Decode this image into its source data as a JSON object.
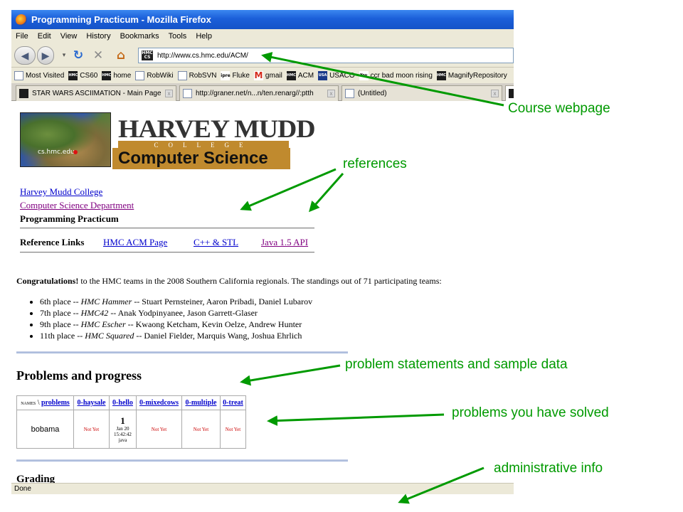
{
  "window": {
    "title": "Programming Practicum - Mozilla Firefox"
  },
  "menu": [
    "File",
    "Edit",
    "View",
    "History",
    "Bookmarks",
    "Tools",
    "Help"
  ],
  "nav": {
    "url": "http://www.cs.hmc.edu/ACM/",
    "url_favicon": "HMC CS"
  },
  "bookmarks": [
    {
      "label": "Most Visited",
      "icon": "page"
    },
    {
      "label": "CS60",
      "icon": "hmc"
    },
    {
      "label": "home",
      "icon": "hmc"
    },
    {
      "label": "RobWiki",
      "icon": "page"
    },
    {
      "label": "RobSVN",
      "icon": "page"
    },
    {
      "label": "Fluke",
      "icon": "ipre"
    },
    {
      "label": "gmail",
      "icon": "mail"
    },
    {
      "label": "ACM",
      "icon": "hmc"
    },
    {
      "label": "USACO",
      "icon": "usaco"
    },
    {
      "label": "ccr bad moon rising",
      "icon": "youtube"
    },
    {
      "label": "MagnifyRepository",
      "icon": "hmc"
    }
  ],
  "tabs": [
    {
      "label": "STAR WARS ASCIIMATION - Main Page"
    },
    {
      "label": "http://graner.net/n...n/ten.renarg//:ptth"
    },
    {
      "label": "(Untitled)"
    }
  ],
  "page": {
    "logo": {
      "name_line": "HARVEY MUDD",
      "college_line": "COLLEGE",
      "dept_line": "Computer Science",
      "map_label": "cs.hmc.edu"
    },
    "breadcrumbs": {
      "college": "Harvey Mudd College",
      "dept": "Computer Science Department",
      "current": "Programming Practicum"
    },
    "reference": {
      "label": "Reference Links",
      "links": [
        "HMC ACM Page",
        "C++ & STL",
        "Java 1.5 API"
      ]
    },
    "congrats": {
      "lead": "Congratulations!",
      "text": " to the HMC teams in the 2008 Southern California regionals. The standings out of 71 participating teams:",
      "teams": [
        {
          "place": "6th place -- ",
          "team": "HMC Hammer",
          "members": " -- Stuart Pernsteiner, Aaron Pribadi, Daniel Lubarov"
        },
        {
          "place": "7th place -- ",
          "team": "HMC42",
          "members": " -- Anak Yodpinyanee, Jason Garrett-Glaser"
        },
        {
          "place": "9th place -- ",
          "team": "HMC Escher",
          "members": " -- Kwaong Ketcham, Kevin Oelze, Andrew Hunter"
        },
        {
          "place": "11th place -- ",
          "team": "HMC Squared",
          "members": " -- Daniel Fielder, Marquis Wang, Joshua Ehrlich"
        }
      ]
    },
    "problems_heading": "Problems and progress",
    "table": {
      "corner_names": "NAMES",
      "corner_sep": " \\ ",
      "corner_problems": "problems",
      "columns": [
        "0-haysale",
        "0-hello",
        "0-mixedcows",
        "0-multiple",
        "0-treat"
      ],
      "row": {
        "user": "bobama",
        "cells": [
          {
            "status": "Not Yet"
          },
          {
            "count": "1",
            "date": "Jan 20",
            "time": "15:42:42",
            "lang": "java"
          },
          {
            "status": "Not Yet"
          },
          {
            "status": "Not Yet"
          },
          {
            "status": "Not Yet"
          }
        ]
      }
    },
    "grading_heading": "Grading"
  },
  "status": "Done",
  "annotations": {
    "course": "Course webpage",
    "references": "references",
    "problems": "problem statements and sample data",
    "solved": "problems you have solved",
    "admin": "administrative info",
    "color": "#009a00"
  }
}
